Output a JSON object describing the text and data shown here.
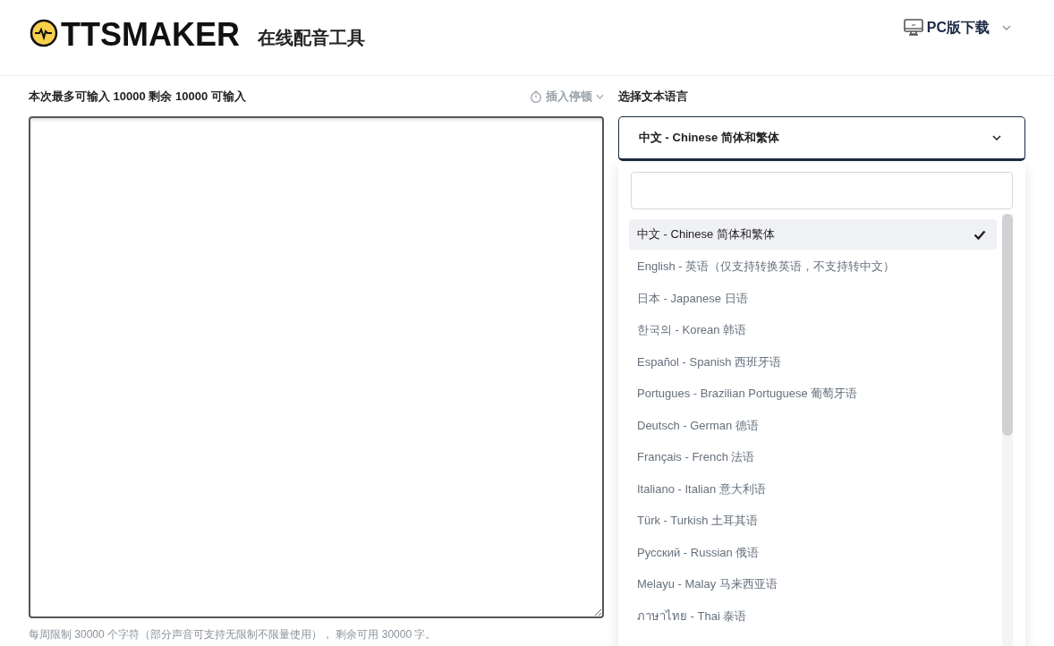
{
  "header": {
    "logo_text": "TTSMAKER",
    "subtitle": "在线配音工具",
    "download": "PC版下载"
  },
  "editor": {
    "limit_label": "本次最多可输入 10000 剩余 10000 可输入",
    "insert_pause": "插入停顿",
    "note": "每周限制 30000 个字符（部分声音可支持无限制不限量使用）， 剩余可用 30000 字。"
  },
  "language": {
    "label": "选择文本语言",
    "value": "中文 - Chinese 简体和繁体",
    "expanded": true,
    "options": [
      {
        "label": "中文 - Chinese 简体和繁体",
        "selected": true
      },
      {
        "label": "English - 英语（仅支持转换英语，不支持转中文）",
        "selected": false
      },
      {
        "label": "日本 - Japanese 日语",
        "selected": false
      },
      {
        "label": "한국의 - Korean 韩语",
        "selected": false
      },
      {
        "label": "Español - Spanish 西班牙语",
        "selected": false
      },
      {
        "label": "Portugues - Brazilian Portuguese 葡萄牙语",
        "selected": false
      },
      {
        "label": "Deutsch - German 德语",
        "selected": false
      },
      {
        "label": "Français - French 法语",
        "selected": false
      },
      {
        "label": "Italiano - Italian 意大利语",
        "selected": false
      },
      {
        "label": "Türk - Turkish 土耳其语",
        "selected": false
      },
      {
        "label": "Русский - Russian 俄语",
        "selected": false
      },
      {
        "label": "Melayu - Malay 马来西亚语",
        "selected": false
      },
      {
        "label": "ภาษาไทย - Thai 泰语",
        "selected": false
      }
    ]
  }
}
